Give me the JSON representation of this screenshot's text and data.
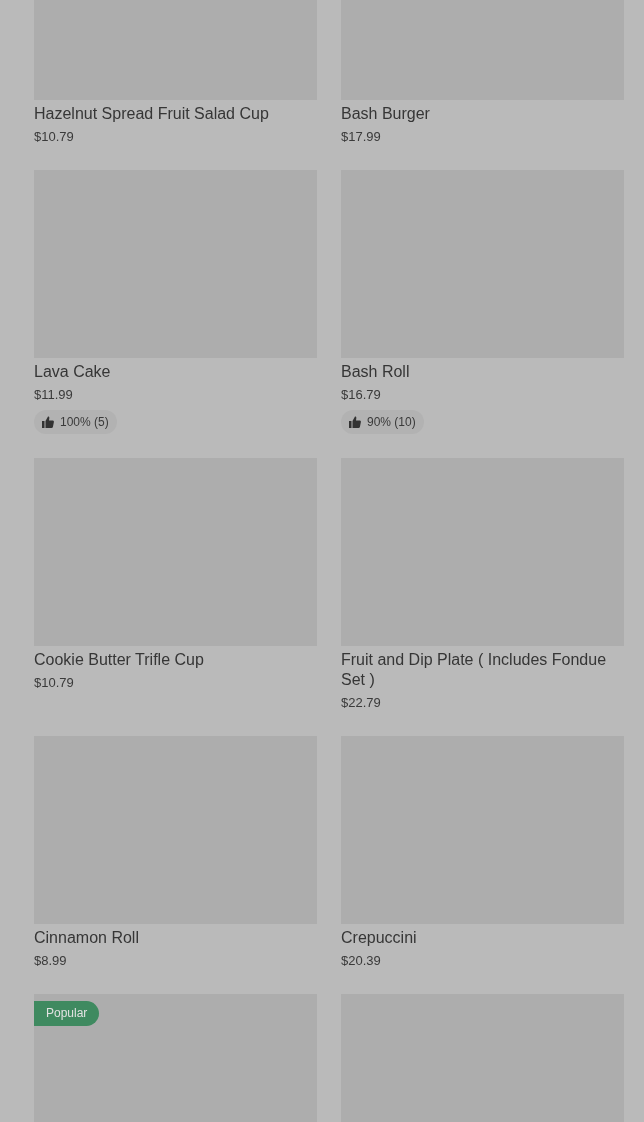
{
  "items": [
    {
      "kind": "product",
      "name": "Hazelnut Spread Fruit Salad Cup",
      "price": "$10.79"
    },
    {
      "kind": "product",
      "name": "Bash Burger",
      "price": "$17.99"
    },
    {
      "kind": "product",
      "name": "Lava Cake",
      "price": "$11.99",
      "rating": "100% (5)"
    },
    {
      "kind": "product",
      "name": "Bash Roll",
      "price": "$16.79",
      "rating": "90% (10)"
    },
    {
      "kind": "product",
      "name": "Cookie Butter Trifle Cup",
      "price": "$10.79"
    },
    {
      "kind": "product",
      "name": "Fruit and Dip Plate ( Includes Fondue Set )",
      "price": "$22.79"
    },
    {
      "kind": "product",
      "name": "Cinnamon Roll",
      "price": "$8.99"
    },
    {
      "kind": "product",
      "name": "Crepuccini",
      "price": "$20.39"
    },
    {
      "kind": "product",
      "badge": "Popular"
    },
    {
      "kind": "product"
    }
  ]
}
